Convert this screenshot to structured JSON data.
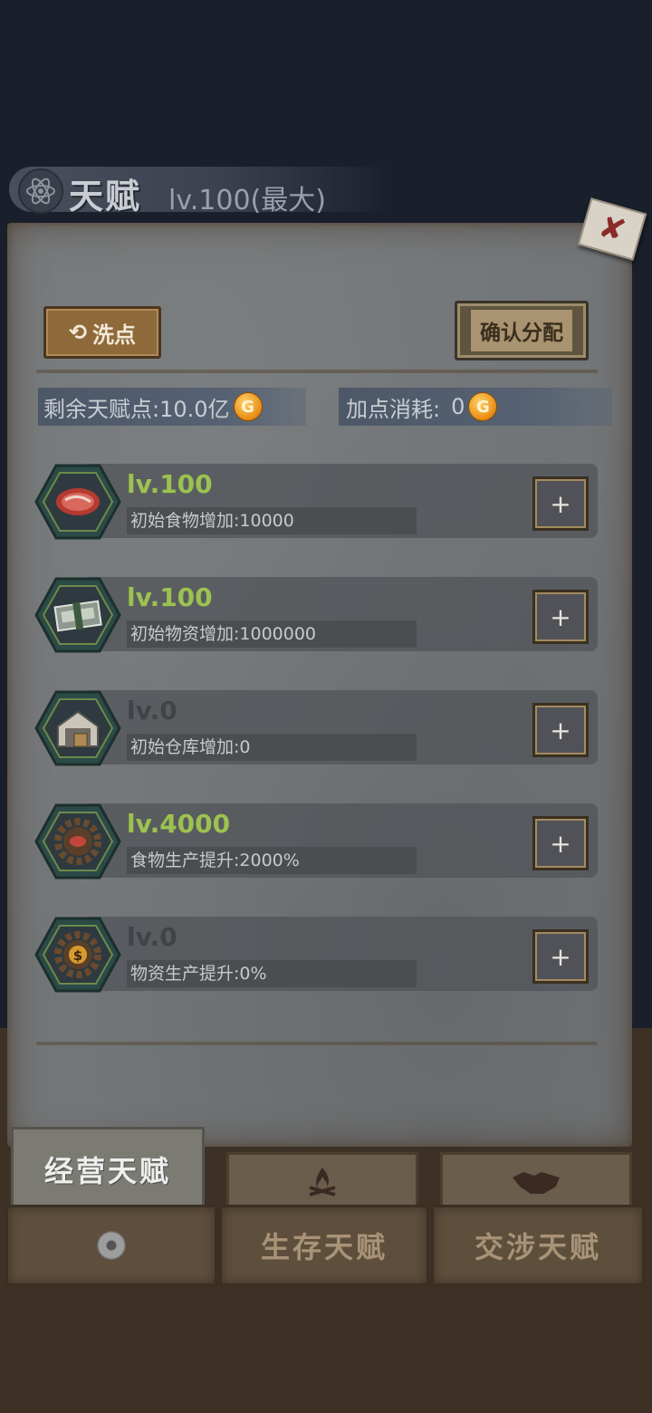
{
  "header": {
    "title": "天赋",
    "level": "lv.100(最大)",
    "icon": "atom-icon"
  },
  "close": {
    "icon": "close-icon",
    "glyph": "✘"
  },
  "toolbar": {
    "reset_label": "洗点",
    "reset_icon": "refresh-icon",
    "confirm_label": "确认分配"
  },
  "points": {
    "remaining_label": "剩余天赋点:",
    "remaining_value": "10.0亿",
    "cost_label": "加点消耗:",
    "cost_value": "0",
    "coin_glyph": "G",
    "coin_icon": "gold-coin-icon"
  },
  "talents": [
    {
      "level": "lv.100",
      "desc": "初始食物增加:10000",
      "icon": "meat-icon",
      "active": true
    },
    {
      "level": "lv.100",
      "desc": "初始物资增加:1000000",
      "icon": "cash-stack-icon",
      "active": true
    },
    {
      "level": "lv.0",
      "desc": "初始仓库增加:0",
      "icon": "warehouse-icon",
      "active": false
    },
    {
      "level": "lv.4000",
      "desc": "食物生产提升:2000%",
      "icon": "gear-meat-icon",
      "active": true
    },
    {
      "level": "lv.0",
      "desc": "物资生产提升:0%",
      "icon": "gear-dollar-icon",
      "active": false
    }
  ],
  "plus_label": "+",
  "tabs": {
    "active_label": "经营天赋",
    "survival_label": "生存天赋",
    "negotiation_label": "交涉天赋",
    "survival_icon": "campfire-icon",
    "negotiation_icon": "handshake-icon",
    "loading_icon": "loading-icon"
  },
  "colors": {
    "active_level": "#9cc24f",
    "inactive_level": "#404347",
    "paper": "#737678",
    "background": "#1a202b"
  }
}
